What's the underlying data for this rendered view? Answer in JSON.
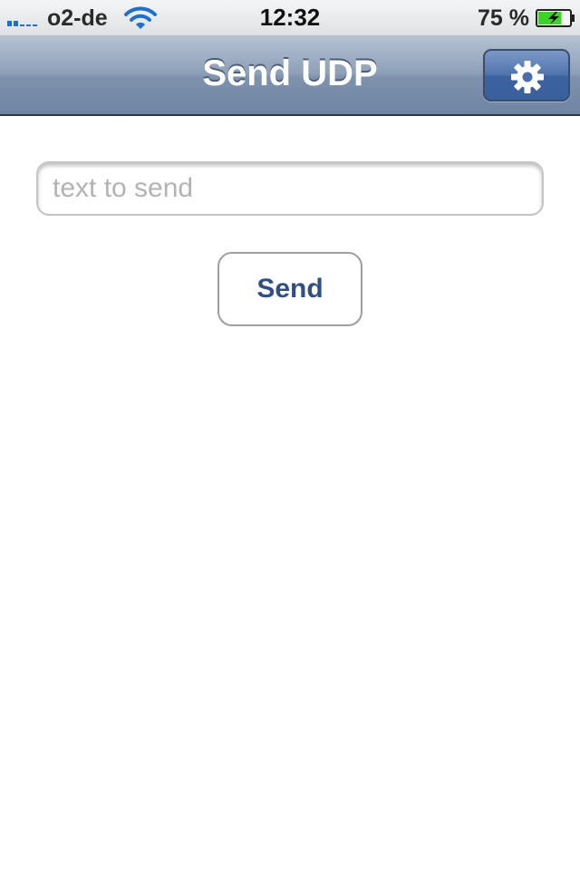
{
  "status_bar": {
    "carrier": "o2-de",
    "time": "12:32",
    "battery_percent": "75 %",
    "battery_level": 0.75,
    "signal_strength": 2,
    "wifi_icon": "wifi-icon",
    "battery_icon": "battery-charging-icon",
    "colors": {
      "signal_active": "#1f6fd0",
      "signal_inactive": "#5a5a5a",
      "battery_fill": "#3fd22b"
    }
  },
  "nav_bar": {
    "title": "Send UDP",
    "settings_icon": "gear-icon"
  },
  "form": {
    "text_field": {
      "placeholder": "text to send",
      "value": ""
    },
    "send_label": "Send"
  },
  "theme": {
    "nav_gradient_top": "#b4c1d2",
    "nav_gradient_bottom": "#6d84a3",
    "button_text": "#324f85"
  }
}
